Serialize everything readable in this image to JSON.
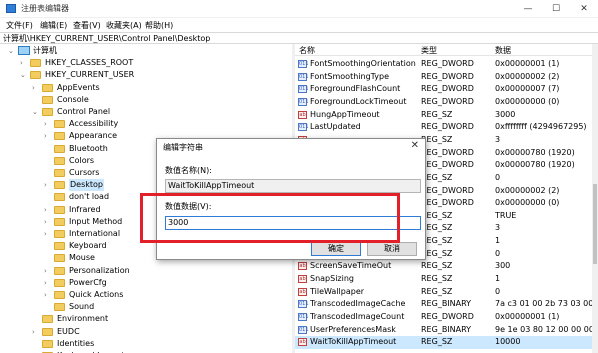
{
  "window": {
    "title": "注册表编辑器",
    "minimize": "—",
    "maximize": "☐",
    "close": "✕"
  },
  "menu": [
    "文件(F)",
    "编辑(E)",
    "查看(V)",
    "收藏夹(A)",
    "帮助(H)"
  ],
  "address": "计算机\\HKEY_CURRENT_USER\\Control Panel\\Desktop",
  "tree": [
    {
      "label": "计算机",
      "arrow": "⌄"
    },
    {
      "label": "HKEY_CLASSES_ROOT",
      "arrow": "›"
    },
    {
      "label": "HKEY_CURRENT_USER",
      "arrow": "⌄"
    },
    {
      "label": "AppEvents",
      "arrow": "›"
    },
    {
      "label": "Console",
      "arrow": ""
    },
    {
      "label": "Control Panel",
      "arrow": "⌄"
    },
    {
      "label": "Accessibility",
      "arrow": "›"
    },
    {
      "label": "Appearance",
      "arrow": "›"
    },
    {
      "label": "Bluetooth",
      "arrow": ""
    },
    {
      "label": "Colors",
      "arrow": ""
    },
    {
      "label": "Cursors",
      "arrow": ""
    },
    {
      "label": "Desktop",
      "arrow": "›"
    },
    {
      "label": "don't load",
      "arrow": ""
    },
    {
      "label": "Infrared",
      "arrow": "›"
    },
    {
      "label": "Input Method",
      "arrow": "›"
    },
    {
      "label": "International",
      "arrow": "›"
    },
    {
      "label": "Keyboard",
      "arrow": ""
    },
    {
      "label": "Mouse",
      "arrow": ""
    },
    {
      "label": "Personalization",
      "arrow": "›"
    },
    {
      "label": "PowerCfg",
      "arrow": "›"
    },
    {
      "label": "Quick Actions",
      "arrow": "›"
    },
    {
      "label": "Sound",
      "arrow": ""
    },
    {
      "label": "Environment",
      "arrow": ""
    },
    {
      "label": "EUDC",
      "arrow": "›"
    },
    {
      "label": "Identities",
      "arrow": ""
    },
    {
      "label": "Keyboard Layout",
      "arrow": "›"
    }
  ],
  "columns": {
    "name": "名称",
    "type": "类型",
    "data": "数据"
  },
  "rows": [
    {
      "icon": "011",
      "name": "FontSmoothingOrientation",
      "type": "REG_DWORD",
      "data": "0x00000001 (1)"
    },
    {
      "icon": "011",
      "name": "FontSmoothingType",
      "type": "REG_DWORD",
      "data": "0x00000002 (2)"
    },
    {
      "icon": "011",
      "name": "ForegroundFlashCount",
      "type": "REG_DWORD",
      "data": "0x00000007 (7)"
    },
    {
      "icon": "011",
      "name": "ForegroundLockTimeout",
      "type": "REG_DWORD",
      "data": "0x00000000 (0)"
    },
    {
      "icon": "ab",
      "name": "HungAppTimeout",
      "type": "REG_SZ",
      "data": "3000"
    },
    {
      "icon": "011",
      "name": "LastUpdated",
      "type": "REG_DWORD",
      "data": "0xffffffff (4294967295)"
    },
    {
      "icon": "ab",
      "name": "",
      "type": "REG_SZ",
      "data": "3"
    },
    {
      "icon": "011",
      "name": "",
      "type": "REG_DWORD",
      "data": "0x00000780 (1920)"
    },
    {
      "icon": "011",
      "name": "",
      "type": "REG_DWORD",
      "data": "0x00000780 (1920)"
    },
    {
      "icon": "ab",
      "name": "",
      "type": "REG_SZ",
      "data": "0"
    },
    {
      "icon": "011",
      "name": "",
      "type": "REG_DWORD",
      "data": "0x00000002 (2)"
    },
    {
      "icon": "011",
      "name": "",
      "type": "REG_DWORD",
      "data": "0x00000000 (0)"
    },
    {
      "icon": "ab",
      "name": "",
      "type": "REG_SZ",
      "data": "TRUE"
    },
    {
      "icon": "ab",
      "name": "",
      "type": "REG_SZ",
      "data": "3"
    },
    {
      "icon": "ab",
      "name": "",
      "type": "REG_SZ",
      "data": "1"
    },
    {
      "icon": "ab",
      "name": "",
      "type": "REG_SZ",
      "data": "0"
    },
    {
      "icon": "ab",
      "name": "ScreenSaveTimeOut",
      "type": "REG_SZ",
      "data": "300"
    },
    {
      "icon": "ab",
      "name": "SnapSizing",
      "type": "REG_SZ",
      "data": "1"
    },
    {
      "icon": "ab",
      "name": "TileWallpaper",
      "type": "REG_SZ",
      "data": "0"
    },
    {
      "icon": "011",
      "name": "TranscodedImageCache",
      "type": "REG_BINARY",
      "data": "7a c3 01 00 2b 73 03 00"
    },
    {
      "icon": "011",
      "name": "TranscodedImageCount",
      "type": "REG_DWORD",
      "data": "0x00000001 (1)"
    },
    {
      "icon": "011",
      "name": "UserPreferencesMask",
      "type": "REG_BINARY",
      "data": "9e 1e 03 80 12 00 00 00"
    },
    {
      "icon": "ab",
      "name": "WaitToKillAppTimeout",
      "type": "REG_SZ",
      "data": "10000"
    }
  ],
  "dialog": {
    "title": "编辑字符串",
    "close": "✕",
    "name_label": "数值名称(N):",
    "name_value": "WaitToKillAppTimeout",
    "data_label": "数值数据(V):",
    "data_value": "3000",
    "ok": "确定",
    "cancel": "取消"
  },
  "colors": {
    "highlight": "#e3202a",
    "selection": "#cce8ff"
  }
}
